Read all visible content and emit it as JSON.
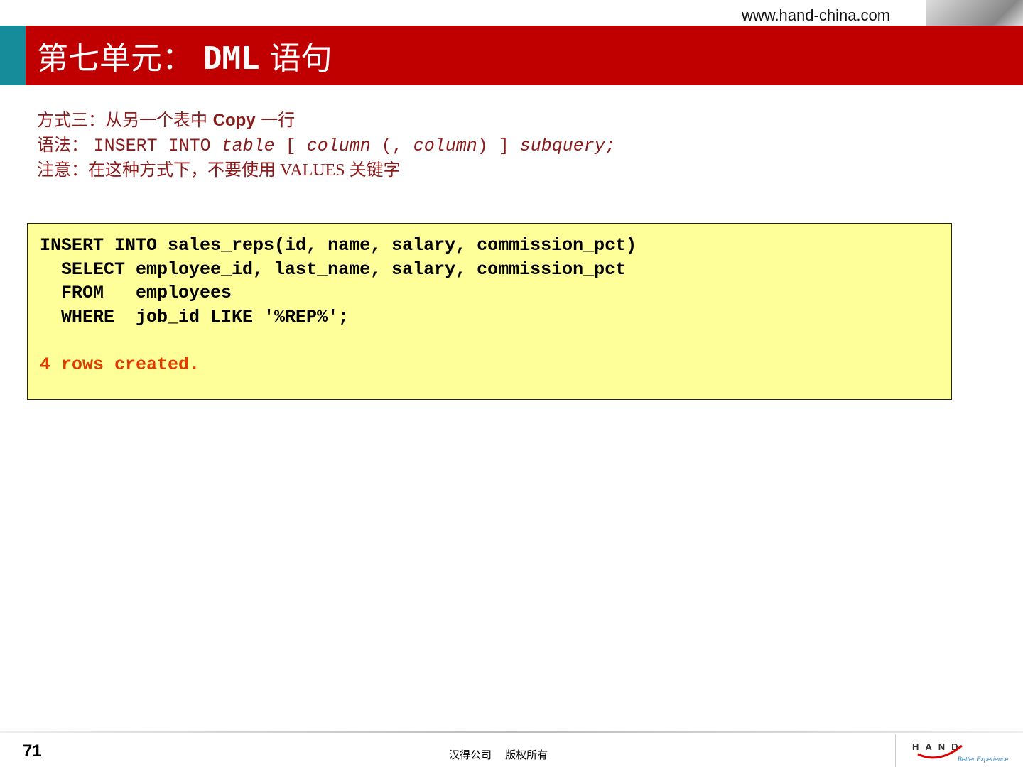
{
  "header": {
    "url": "www.hand-china.com",
    "title_prefix": "第七单元：",
    "title_code": "DML",
    "title_suffix": "语句"
  },
  "intro": {
    "line1_a": "方式三：从另一个表中 ",
    "line1_b": "Copy",
    "line1_c": " 一行",
    "line2_label": "语法： ",
    "line2_a": "INSERT INTO ",
    "line2_b": "table",
    "line2_c": " [ ",
    "line2_d": "column",
    "line2_e": " (, ",
    "line2_f": "column",
    "line2_g": ") ] ",
    "line2_h": "subquery;",
    "line3": "注意：在这种方式下，不要使用 VALUES 关键字"
  },
  "code": {
    "sql": "INSERT INTO sales_reps(id, name, salary, commission_pct)\n  SELECT employee_id, last_name, salary, commission_pct\n  FROM   employees\n  WHERE  job_id LIKE '%REP%';",
    "result": "4 rows created."
  },
  "footer": {
    "page": "71",
    "copyright": "汉得公司    版权所有",
    "logo_text": "HAND",
    "logo_tagline": "Better Experience"
  }
}
